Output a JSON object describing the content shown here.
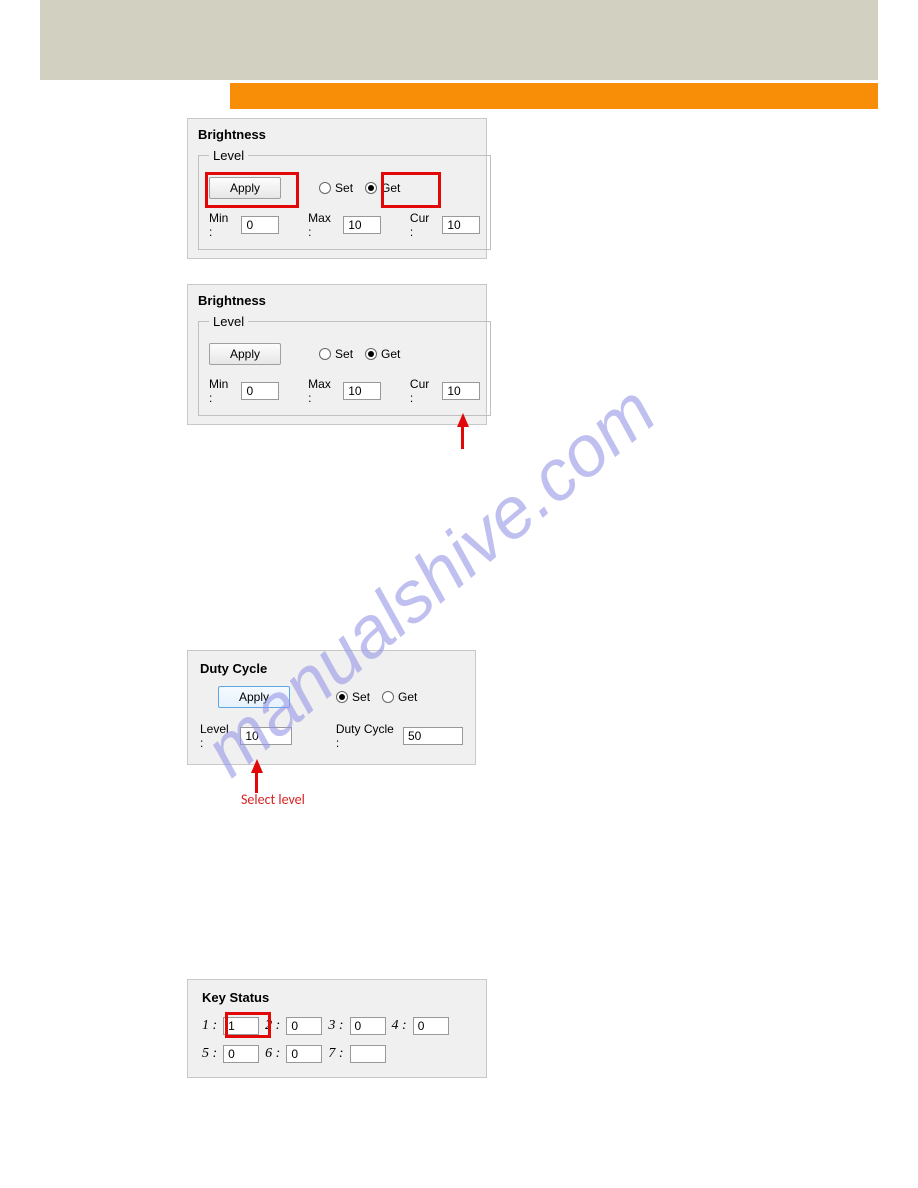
{
  "header": {},
  "brightness1": {
    "title": "Brightness",
    "legend": "Level",
    "apply": "Apply",
    "set_label": "Set",
    "get_label": "Get",
    "mode": "get",
    "min_label": "Min :",
    "min_value": "0",
    "max_label": "Max :",
    "max_value": "10",
    "cur_label": "Cur :",
    "cur_value": "10"
  },
  "brightness2": {
    "title": "Brightness",
    "legend": "Level",
    "apply": "Apply",
    "set_label": "Set",
    "get_label": "Get",
    "mode": "get",
    "min_label": "Min :",
    "min_value": "0",
    "max_label": "Max :",
    "max_value": "10",
    "cur_label": "Cur :",
    "cur_value": "10"
  },
  "duty": {
    "legend": "Duty Cycle",
    "apply": "Apply",
    "set_label": "Set",
    "get_label": "Get",
    "mode": "set",
    "level_label": "Level :",
    "level_value": "10",
    "cycle_label": "Duty Cycle :",
    "cycle_value": "50",
    "annotation": "Select level"
  },
  "keystatus": {
    "legend": "Key Status",
    "labels": [
      "1 :",
      "2 :",
      "3 :",
      "4 :",
      "5 :",
      "6 :",
      "7 :"
    ],
    "values": [
      "1",
      "0",
      "0",
      "0",
      "0",
      "0",
      ""
    ]
  },
  "watermark": "manualshive.com"
}
